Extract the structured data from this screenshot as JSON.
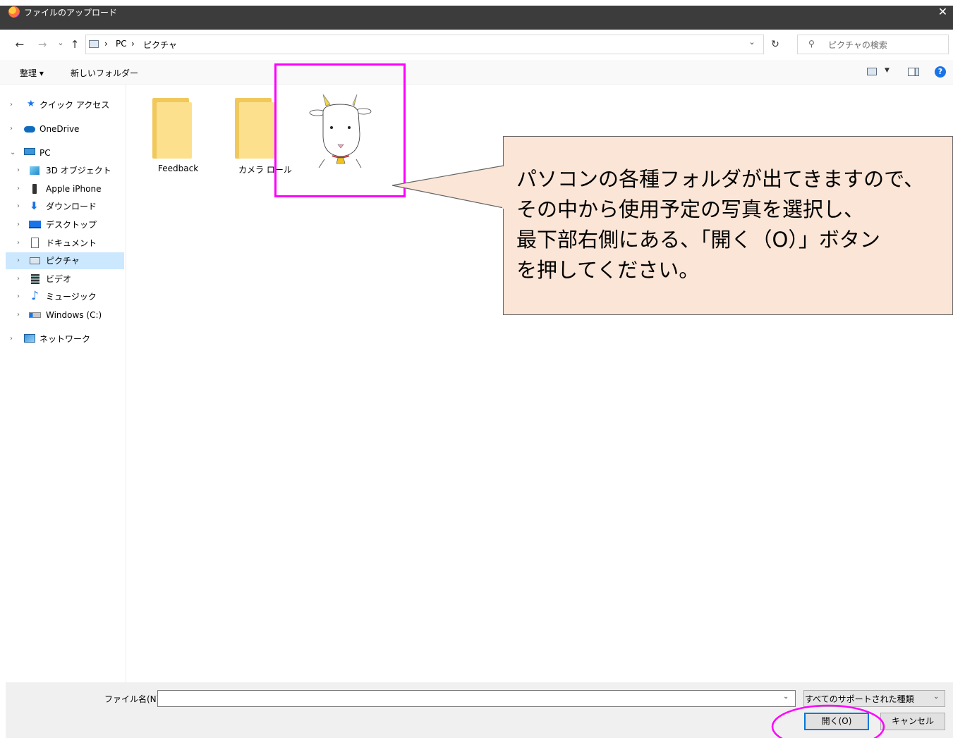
{
  "window": {
    "title": "ファイルのアップロード",
    "close": "✕"
  },
  "nav": {
    "back": "←",
    "forward": "→",
    "recent": "⌄",
    "up": "↑",
    "breadcrumb": [
      "PC",
      "ピクチャ"
    ],
    "separator": "›",
    "refresh": "↻",
    "search_placeholder": "ピクチャの検索"
  },
  "toolbar": {
    "organize": "整理 ▾",
    "new_folder": "新しいフォルダー"
  },
  "sidebar": {
    "items": [
      {
        "label": "クイック アクセス",
        "chevron": "›"
      },
      {
        "label": "OneDrive",
        "chevron": "›"
      },
      {
        "label": "PC",
        "chevron": "⌄"
      },
      {
        "label": "3D オブジェクト",
        "chevron": "›"
      },
      {
        "label": "Apple iPhone",
        "chevron": "›"
      },
      {
        "label": "ダウンロード",
        "chevron": "›"
      },
      {
        "label": "デスクトップ",
        "chevron": "›"
      },
      {
        "label": "ドキュメント",
        "chevron": "›"
      },
      {
        "label": "ピクチャ",
        "chevron": "›"
      },
      {
        "label": "ビデオ",
        "chevron": "›"
      },
      {
        "label": "ミュージック",
        "chevron": "›"
      },
      {
        "label": "Windows (C:)",
        "chevron": "›"
      },
      {
        "label": "ネットワーク",
        "chevron": "›"
      }
    ]
  },
  "content": {
    "items": [
      {
        "label": "Feedback"
      },
      {
        "label": "カメラ ロール"
      }
    ]
  },
  "callout": {
    "lines": [
      "パソコンの各種フォルダが出てきますので、",
      "その中から使用予定の写真を選択し、",
      "最下部右側にある、「開く（O）」ボタン",
      "を押してください。"
    ]
  },
  "bottom": {
    "filename_label": "ファイル名(N):",
    "filename_value": "",
    "filetype": "すべてのサポートされた種類",
    "open": "開く(O)",
    "cancel": "キャンセル"
  },
  "colors": {
    "highlight": "#ff00ff",
    "callout_fill": "#fbe5d6",
    "selected": "#cce8ff",
    "accent": "#0078d7"
  }
}
